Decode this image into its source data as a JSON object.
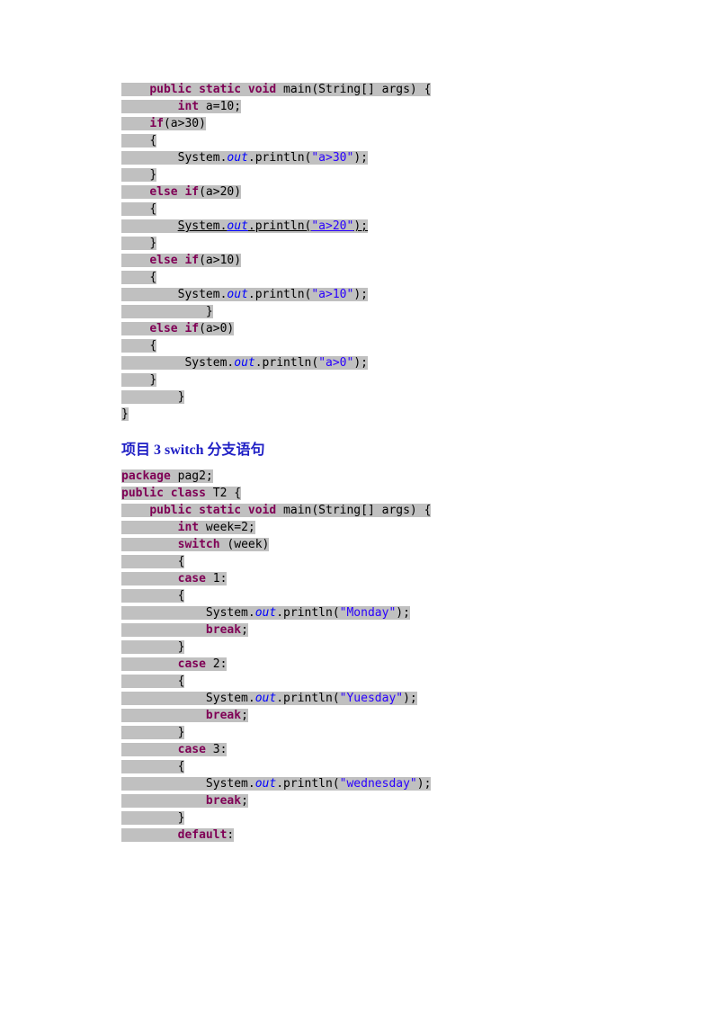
{
  "code1": {
    "l1": {
      "indent": "    ",
      "t1": "public",
      "sp1": " ",
      "t2": "static",
      "sp2": " ",
      "t3": "void",
      "sp3": " main(String[] args) {"
    },
    "l2": {
      "indent": "        ",
      "t1": "int",
      "sp": " a=10;"
    },
    "l3": {
      "indent": "    ",
      "t1": "if",
      "rest": "(a>30)"
    },
    "l4": {
      "indent": "    ",
      "t": "{"
    },
    "l5": {
      "indent": "        ",
      "pre": "System.",
      "out": "out",
      "post": ".println(",
      "str": "\"a>30\"",
      "end": ");"
    },
    "l6": {
      "indent": "    ",
      "t": "}"
    },
    "l7": {
      "indent": "    ",
      "t1": "else",
      "sp": " ",
      "t2": "if",
      "rest": "(a>20)"
    },
    "l8": {
      "indent": "    ",
      "t": "{"
    },
    "l9": {
      "indent": "        ",
      "pre": "System.",
      "out": "out",
      "post": ".println(",
      "str": "\"a>20\"",
      "end": ");"
    },
    "l10": {
      "indent": "    ",
      "t": "}"
    },
    "l11": {
      "indent": "    ",
      "t1": "else",
      "sp": " ",
      "t2": "if",
      "rest": "(a>10)"
    },
    "l12": {
      "indent": "    ",
      "t": "{"
    },
    "l13": {
      "indent": "        ",
      "pre": "System.",
      "out": "out",
      "post": ".println(",
      "str": "\"a>10\"",
      "end": ");"
    },
    "l14": {
      "indent": "            ",
      "t": "}"
    },
    "l15": {
      "indent": "    ",
      "t1": "else",
      "sp": " ",
      "t2": "if",
      "rest": "(a>0)"
    },
    "l16": {
      "indent": "    ",
      "t": "{"
    },
    "l17": {
      "indent": "         ",
      "pre": "System.",
      "out": "out",
      "post": ".println(",
      "str": "\"a>0\"",
      "end": ");"
    },
    "l18": {
      "indent": "    ",
      "t": "}"
    },
    "l19": {
      "indent": "        ",
      "t": "}"
    },
    "l20": {
      "indent": "",
      "t": "}"
    }
  },
  "heading": "项目 3 switch 分支语句",
  "code2": {
    "l1": {
      "t1": "package",
      "rest": " pag2;"
    },
    "l2": {
      "t1": "public",
      "sp1": " ",
      "t2": "class",
      "rest": " T2 {"
    },
    "l3": {
      "indent": "    ",
      "t1": "public",
      "sp1": " ",
      "t2": "static",
      "sp2": " ",
      "t3": "void",
      "rest": " main(String[] args) {"
    },
    "l4": {
      "indent": "        ",
      "t1": "int",
      "rest": " week=2;"
    },
    "l5": {
      "indent": "        ",
      "t1": "switch",
      "rest": " (week)"
    },
    "l6": {
      "indent": "        ",
      "t": "{"
    },
    "l7": {
      "indent": "        ",
      "t1": "case",
      "rest": " 1:"
    },
    "l8": {
      "indent": "        ",
      "t": "{"
    },
    "l9": {
      "indent": "            ",
      "pre": "System.",
      "out": "out",
      "post": ".println(",
      "str": "\"Monday\"",
      "end": ");"
    },
    "l10": {
      "indent": "            ",
      "t1": "break",
      "rest": ";"
    },
    "l11": {
      "indent": "        ",
      "t": "}"
    },
    "l12": {
      "indent": "        ",
      "t1": "case",
      "rest": " 2:"
    },
    "l13": {
      "indent": "        ",
      "t": "{"
    },
    "l14": {
      "indent": "            ",
      "pre": "System.",
      "out": "out",
      "post": ".println(",
      "str": "\"Yuesday\"",
      "end": ");"
    },
    "l15": {
      "indent": "            ",
      "t1": "break",
      "rest": ";"
    },
    "l16": {
      "indent": "        ",
      "t": "}"
    },
    "l17": {
      "indent": "        ",
      "t1": "case",
      "rest": " 3:"
    },
    "l18": {
      "indent": "        ",
      "t": "{"
    },
    "l19": {
      "indent": "            ",
      "pre": "System.",
      "out": "out",
      "post": ".println(",
      "str": "\"wednesday\"",
      "end": ");"
    },
    "l20": {
      "indent": "            ",
      "t1": "break",
      "rest": ";"
    },
    "l21": {
      "indent": "        ",
      "t": "}"
    },
    "l22": {
      "indent": "        ",
      "t1": "default",
      "rest": ":"
    }
  }
}
